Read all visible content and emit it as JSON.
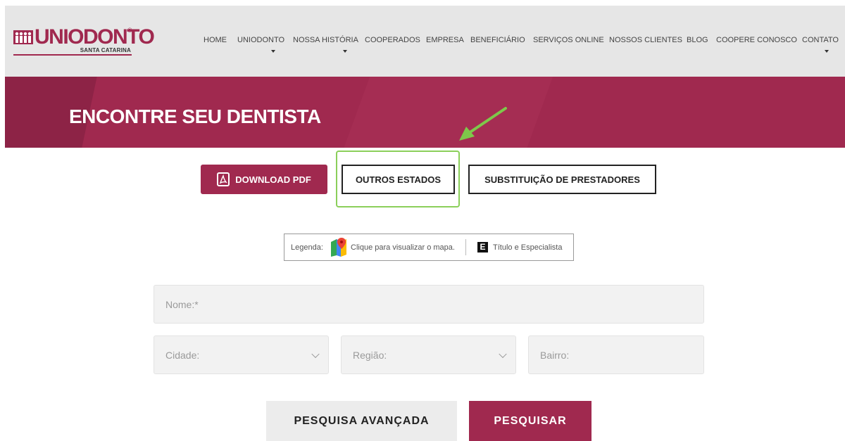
{
  "brand": {
    "name": "UNIODONTO",
    "registered": "®",
    "subtitle": "SANTA CATARINA",
    "color": "#a0294f"
  },
  "nav": {
    "items": [
      {
        "label": "HOME",
        "has_dropdown": false
      },
      {
        "label": "UNIODONTO",
        "has_dropdown": true
      },
      {
        "label": "NOSSA HISTÓRIA",
        "has_dropdown": true
      },
      {
        "label": "COOPERADOS",
        "has_dropdown": false
      },
      {
        "label": "EMPRESA",
        "has_dropdown": false
      },
      {
        "label": "BENEFICIÁRIO",
        "has_dropdown": false
      },
      {
        "label": "SERVIÇOS ONLINE",
        "has_dropdown": false
      },
      {
        "label": "NOSSOS CLIENTES",
        "has_dropdown": false
      },
      {
        "label": "BLOG",
        "has_dropdown": false
      },
      {
        "label": "COOPERE CONOSCO",
        "has_dropdown": false
      },
      {
        "label": "CONTATO",
        "has_dropdown": true
      }
    ]
  },
  "banner": {
    "title": "ENCONTRE SEU DENTISTA"
  },
  "actions": {
    "download_pdf": "DOWNLOAD PDF",
    "outros_estados": "OUTROS ESTADOS",
    "substituicao": "SUBSTITUIÇÃO DE PRESTADORES"
  },
  "legend": {
    "label": "Legenda:",
    "map_text": "Clique para visualizar o mapa.",
    "e_letter": "E",
    "e_text": "Título e Especialista"
  },
  "form": {
    "nome_placeholder": "Nome:*",
    "cidade_placeholder": "Cidade:",
    "regiao_placeholder": "Região:",
    "bairro_placeholder": "Bairro:",
    "advanced_label": "PESQUISA AVANÇADA",
    "search_label": "PESQUISAR"
  },
  "annotation": {
    "arrow_color": "#7ec84a",
    "highlight_color": "#8bcf5a"
  }
}
